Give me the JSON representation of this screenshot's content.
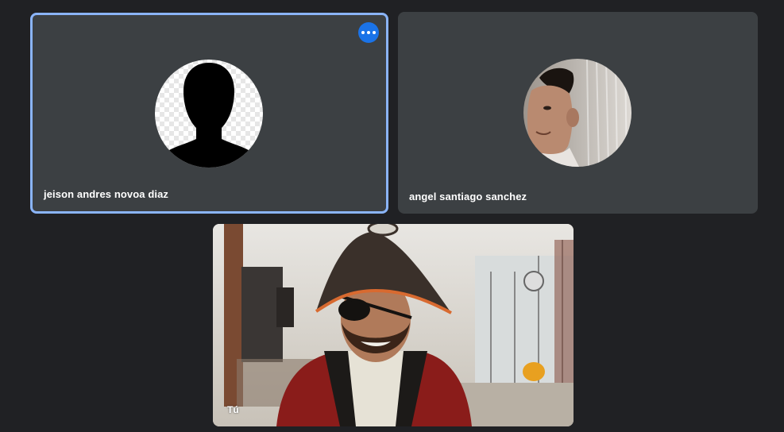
{
  "participants": [
    {
      "name": "jeison andres novoa diaz",
      "active": true,
      "more_icon": "more-horizontal-icon"
    },
    {
      "name": "angel santiago sanchez",
      "active": false
    }
  ],
  "self_view": {
    "label": "Tú"
  },
  "colors": {
    "background": "#202124",
    "tile": "#3c4043",
    "active_border": "#8ab4f8",
    "accent": "#1a73e8"
  }
}
